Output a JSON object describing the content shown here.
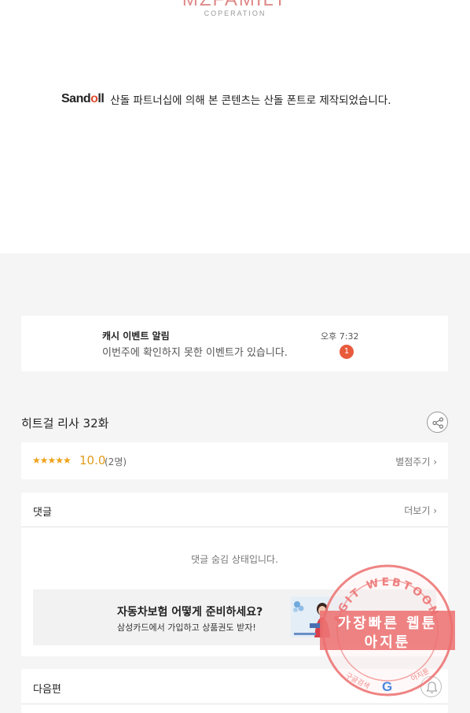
{
  "header": {
    "logo_main": "MZFAMILY",
    "logo_sub": "COPERATION"
  },
  "sandoll": {
    "logo_prefix": "Sand",
    "logo_o": "o",
    "logo_suffix": "ll",
    "notice": "산돌 파트너십에 의해 본 콘텐츠는 산돌 폰트로 제작되었습니다."
  },
  "notification": {
    "title": "캐시 이벤트 알림",
    "body": "이번주에 확인하지 못한 이벤트가 있습니다.",
    "time": "오후 7:32",
    "badge": "1"
  },
  "episode": {
    "title": "히트걸 리사 32화"
  },
  "rating": {
    "stars": "★★★★★",
    "score": "10.0",
    "count": "(2명)",
    "rate_label": "별점주기 ›"
  },
  "comments": {
    "title": "댓글",
    "more_label": "더보기 ›",
    "hidden_msg": "댓글 숨김 상태입니다."
  },
  "ad": {
    "title": "자동차보험 어떻게 준비하세요?",
    "subtitle": "삼성카드에서 가입하고 상품권도 받자!"
  },
  "next_episode": {
    "title": "다음편"
  },
  "watermark": {
    "ring_text": "AGIT WEBTOON",
    "line1": "가장빠른 웹툰",
    "line2": "아지툰",
    "bottom_left": "구글검색",
    "bottom_right": "아지툰",
    "google_letter": "G"
  },
  "colors": {
    "accent_red": "#e85a3c",
    "star": "#f0a21c",
    "watermark": "#ec6e6e"
  }
}
